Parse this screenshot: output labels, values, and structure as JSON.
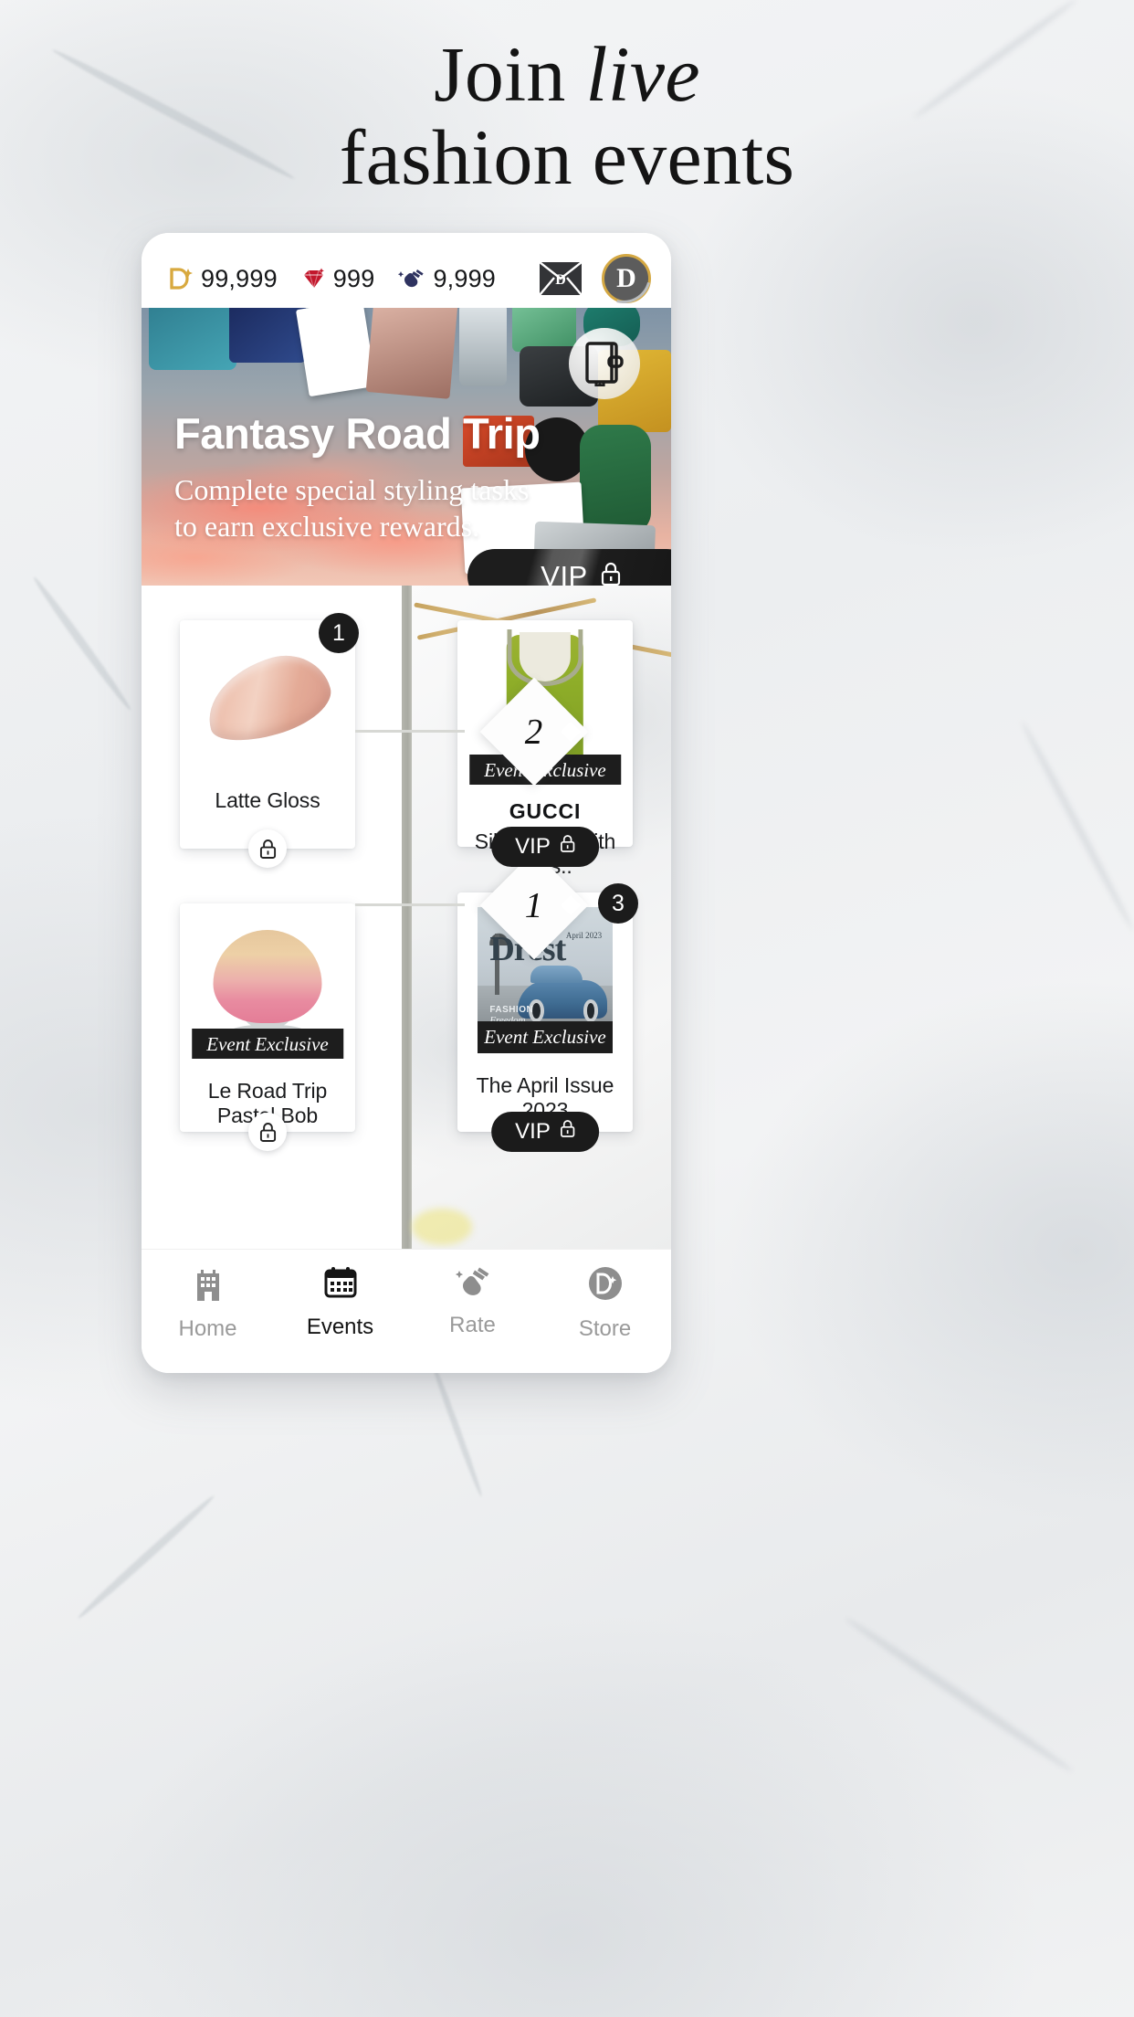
{
  "promo": {
    "line1_pre": "Join ",
    "line1_em": "live",
    "line2": "fashion events"
  },
  "app": {
    "topbar": {
      "coins": {
        "icon": "drest-coin-icon",
        "value": "99,999"
      },
      "gems": {
        "icon": "gem-icon",
        "value": "999"
      },
      "claps": {
        "icon": "clap-icon",
        "value": "9,999"
      },
      "mail_icon": "mail-envelope-icon",
      "avatar_letter": "D"
    },
    "hero": {
      "title": "Fantasy Road Trip",
      "subtitle_line1": "Complete special styling tasks",
      "subtitle_line2": "to earn exclusive rewards.",
      "journal_icon": "journal-icon",
      "vip_label": "VIP",
      "vip_lock_icon": "lock-icon"
    },
    "board": {
      "nodes": [
        {
          "label": "2"
        },
        {
          "label": "1"
        }
      ],
      "cards": [
        {
          "name": "Latte Gloss",
          "brand": "",
          "badge": "1",
          "exclusive": "",
          "locked_icon": "lock-icon",
          "vip": ""
        },
        {
          "name": "Silk Dress With Crys..",
          "brand": "GUCCI",
          "badge": "",
          "exclusive": "Event Exclusive",
          "locked_icon": "",
          "vip": "VIP"
        },
        {
          "name": "Le Road Trip Pastel Bob",
          "brand": "",
          "badge": "",
          "exclusive": "Event Exclusive",
          "locked_icon": "lock-icon",
          "vip": ""
        },
        {
          "name": "The April Issue 2023",
          "brand": "",
          "badge": "3",
          "exclusive": "Event Exclusive",
          "locked_icon": "",
          "vip": "VIP",
          "cover": {
            "masthead": "Drest",
            "issue": "April 2023",
            "line1": "FASHION",
            "line2": "Freedom"
          }
        }
      ]
    },
    "nav": [
      {
        "label": "Home",
        "icon": "building-icon",
        "active": false
      },
      {
        "label": "Events",
        "icon": "calendar-icon",
        "active": true
      },
      {
        "label": "Rate",
        "icon": "clap-hands-icon",
        "active": false
      },
      {
        "label": "Store",
        "icon": "drest-coin-icon",
        "active": false
      }
    ]
  },
  "colors": {
    "gold": "#d4a843",
    "ink": "#1b1b1b",
    "muted": "#9a9a9a",
    "gem_red": "#c2172c",
    "clap_navy": "#2f3360"
  }
}
